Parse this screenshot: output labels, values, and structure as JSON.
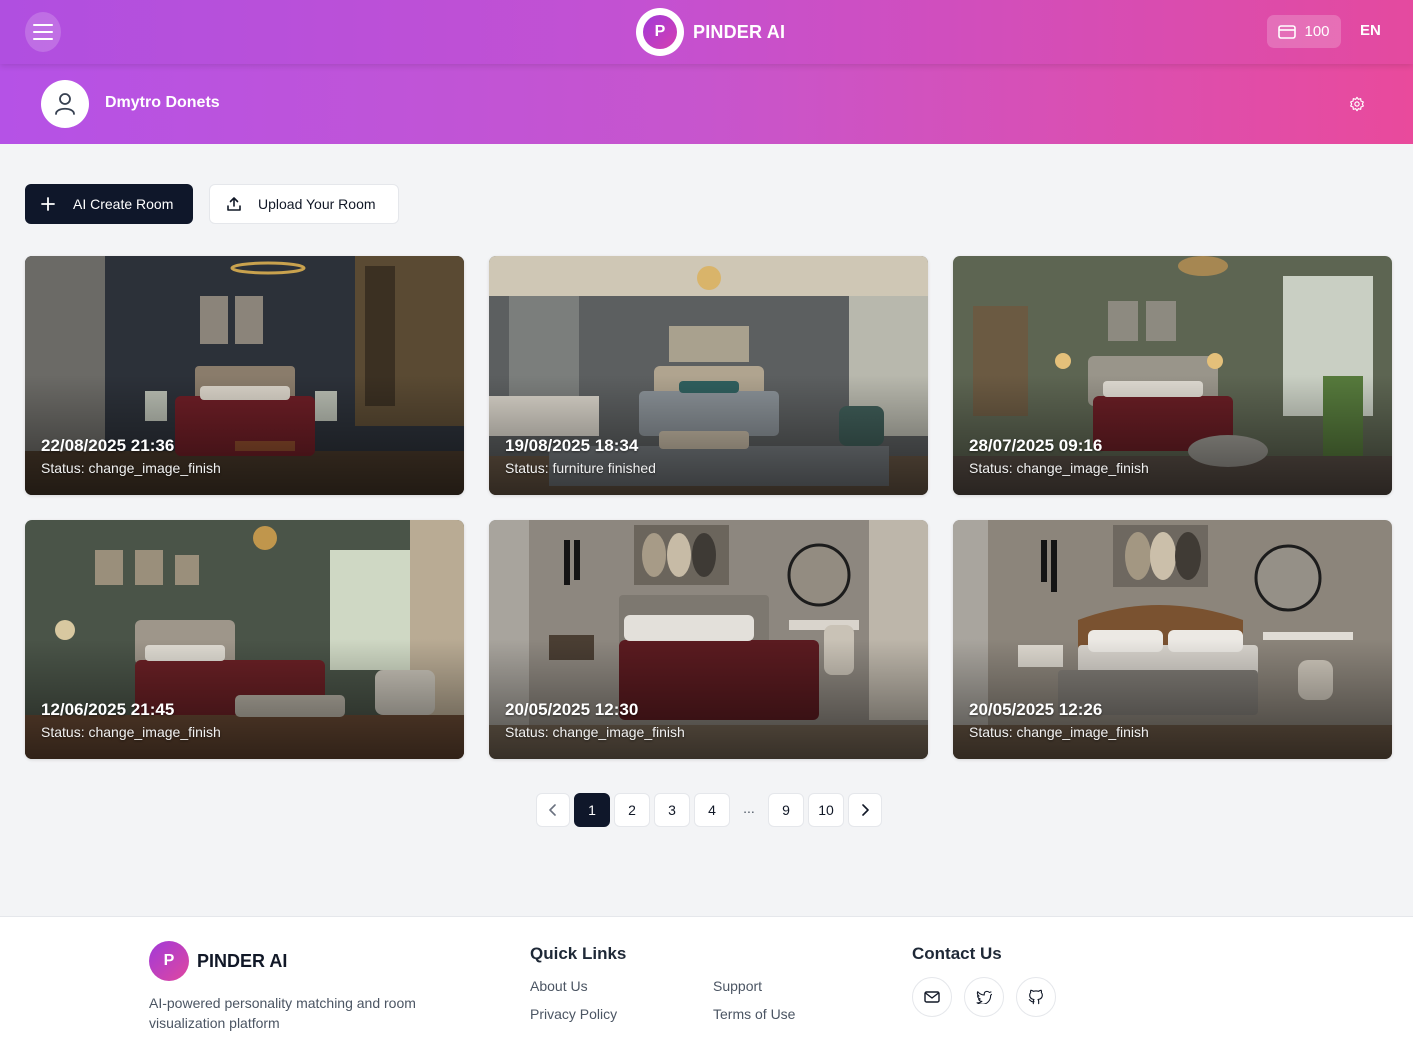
{
  "header": {
    "brand_letter": "P",
    "brand_name": "PINDER AI",
    "credits": "100",
    "language": "EN"
  },
  "profile": {
    "name": "Dmytro Donets"
  },
  "actions": {
    "create_label": "AI Create Room",
    "upload_label": "Upload Your Room"
  },
  "rooms": [
    {
      "date": "22/08/2025 21:36",
      "status": "Status: change_image_finish"
    },
    {
      "date": "19/08/2025 18:34",
      "status": "Status: furniture finished"
    },
    {
      "date": "28/07/2025 09:16",
      "status": "Status: change_image_finish"
    },
    {
      "date": "12/06/2025 21:45",
      "status": "Status: change_image_finish"
    },
    {
      "date": "20/05/2025 12:30",
      "status": "Status: change_image_finish"
    },
    {
      "date": "20/05/2025 12:26",
      "status": "Status: change_image_finish"
    }
  ],
  "pagination": {
    "pages": [
      "1",
      "2",
      "3",
      "4",
      "9",
      "10"
    ],
    "ellipsis": "...",
    "current": "1"
  },
  "footer": {
    "brand_letter": "P",
    "brand_name": "PINDER AI",
    "description": "AI-powered personality matching and room visualization platform",
    "quick_links_title": "Quick Links",
    "links": {
      "about": "About Us",
      "support": "Support",
      "privacy": "Privacy Policy",
      "terms": "Terms of Use"
    },
    "contact_title": "Contact Us"
  },
  "icons": {
    "menu": "menu-icon",
    "wallet": "wallet-icon",
    "user": "user-icon",
    "settings": "gear-icon",
    "plus": "plus-icon",
    "upload": "upload-icon",
    "prev": "chevron-left-icon",
    "next": "chevron-right-icon",
    "mail": "mail-icon",
    "twitter": "twitter-icon",
    "github": "github-icon"
  },
  "colors": {
    "primary_dark": "#0f172a",
    "gradient_start": "#b04fe0",
    "gradient_end": "#e44a9f"
  }
}
